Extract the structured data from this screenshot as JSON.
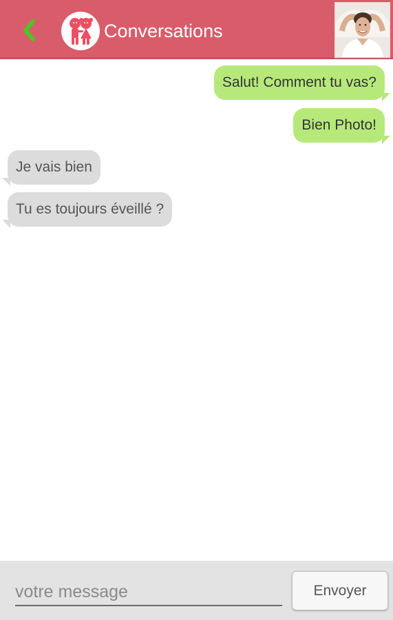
{
  "header": {
    "title": "Conversations",
    "back_icon": "chevron-left-icon",
    "logo_icon": "couple-logo-icon",
    "avatar_icon": "user-avatar-photo",
    "colors": {
      "bar": "#d95c6a",
      "back_arrow": "#4fc325",
      "logo_figures": "#ec4f63"
    }
  },
  "messages": [
    {
      "direction": "sent",
      "text": "Salut! Comment tu vas?"
    },
    {
      "direction": "sent",
      "text": "Bien Photo!"
    },
    {
      "direction": "received",
      "text": "Je vais bien"
    },
    {
      "direction": "received",
      "text": "Tu es toujours éveillé ?"
    }
  ],
  "colors": {
    "sent_bubble": "#b6e97a",
    "received_bubble": "#dcdcdc"
  },
  "composer": {
    "placeholder": "votre message",
    "value": "",
    "send_label": "Envoyer"
  }
}
